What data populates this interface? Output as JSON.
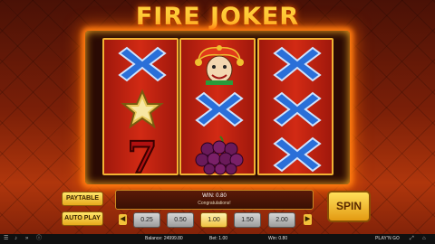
{
  "title": "FIRE JOKER",
  "reels": [
    {
      "symbols": [
        {
          "name": "x-icon"
        },
        {
          "name": "star-icon"
        },
        {
          "name": "seven-icon",
          "label": "7"
        }
      ]
    },
    {
      "symbols": [
        {
          "name": "joker-icon"
        },
        {
          "name": "x-icon"
        },
        {
          "name": "grapes-icon"
        }
      ]
    },
    {
      "symbols": [
        {
          "name": "x-icon"
        },
        {
          "name": "x-icon"
        },
        {
          "name": "x-icon"
        }
      ]
    }
  ],
  "buttons": {
    "paytable": "PAYTABLE",
    "autoplay": "AUTO PLAY",
    "spin": "SPIN",
    "bet_decrease": "◀",
    "bet_increase": "▶"
  },
  "message": {
    "win": "WIN:  0.80",
    "congrats": "Congratulations!"
  },
  "bet_options": [
    "0.25",
    "0.50",
    "1.00",
    "1.50",
    "2.00"
  ],
  "selected_bet": "1.00",
  "status": {
    "balance": "Balance: 24999.80",
    "bet": "Bet: 1.00",
    "win": "Win: 0.80",
    "logo": "PLAY'N GO"
  },
  "colors": {
    "accent": "#ffcf3a",
    "reel": "#d22a14",
    "x_blue": "#2a6fd8"
  }
}
